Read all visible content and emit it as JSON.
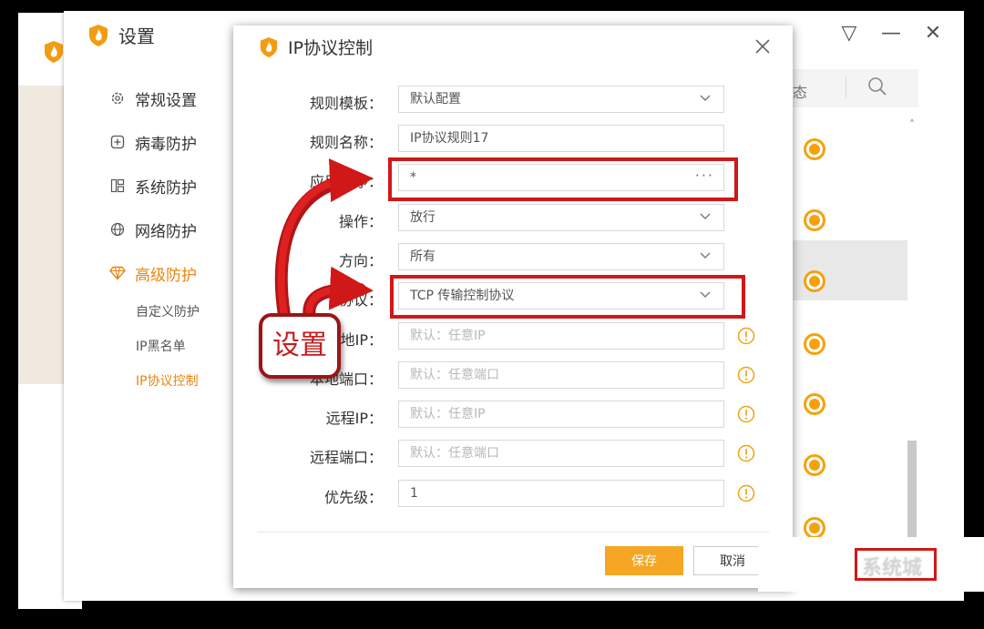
{
  "settings_window": {
    "title": "设置",
    "controls": {
      "menu": "▽",
      "minimize": "—",
      "close": "✕"
    }
  },
  "sidebar": {
    "items": [
      {
        "label": "常规设置",
        "icon": "gear-icon"
      },
      {
        "label": "病毒防护",
        "icon": "plus-box-icon"
      },
      {
        "label": "系统防护",
        "icon": "grid-icon"
      },
      {
        "label": "网络防护",
        "icon": "globe-icon"
      },
      {
        "label": "高级防护",
        "icon": "diamond-icon"
      }
    ],
    "sub_items": [
      "自定义防护",
      "IP黑名单",
      "IP协议控制"
    ]
  },
  "right_panel": {
    "status_label": "态",
    "scroll_up": "˄",
    "scroll_down": "˅"
  },
  "dialog": {
    "title": "IP协议控制",
    "rows": [
      {
        "label": "规则模板：",
        "value": "默认配置",
        "kind": "select"
      },
      {
        "label": "规则名称：",
        "value": "IP协议规则17",
        "kind": "text"
      },
      {
        "label": "应用程序：",
        "value": "*",
        "kind": "picker",
        "picker": "···"
      },
      {
        "label": "操作：",
        "value": "放行",
        "kind": "select"
      },
      {
        "label": "方向：",
        "value": "所有",
        "kind": "select"
      },
      {
        "label": "协议：",
        "value": "TCP 传输控制协议",
        "kind": "select"
      },
      {
        "label": "本地IP：",
        "placeholder": "默认：任意IP",
        "kind": "info"
      },
      {
        "label": "本地端口：",
        "placeholder": "默认：任意端口",
        "kind": "info"
      },
      {
        "label": "远程IP：",
        "placeholder": "默认：任意IP",
        "kind": "info"
      },
      {
        "label": "远程端口：",
        "placeholder": "默认：任意端口",
        "kind": "info"
      },
      {
        "label": "优先级：",
        "value": "1",
        "kind": "info"
      }
    ],
    "save_label": "保存",
    "cancel_label": "取消"
  },
  "annotation": {
    "label": "设置"
  },
  "watermark": {
    "text": "系统城"
  },
  "colors": {
    "accent": "#f5a623",
    "active_text": "#e8850c",
    "annotation_red": "#d01818"
  }
}
